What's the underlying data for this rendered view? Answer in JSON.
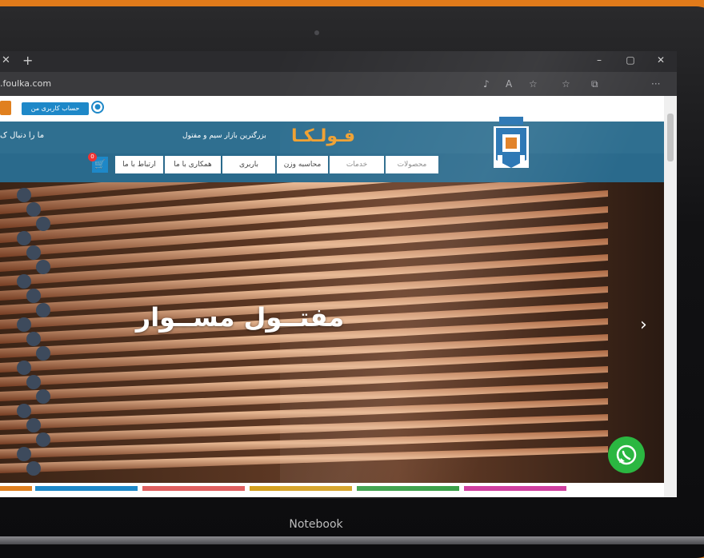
{
  "browser": {
    "tab_close": "✕",
    "tab_new": "+",
    "url": ".foulka.com",
    "controls": {
      "minimize": "–",
      "restore": "▢",
      "close": "✕"
    },
    "toolbar_icons": [
      "read-aloud-icon",
      "text-size-icon",
      "favorite-add-icon",
      "favorites-icon",
      "collections-icon",
      "more-icon"
    ],
    "more_label": "···"
  },
  "site": {
    "account_button": "حساب کاربری من",
    "follow_us": "ما را دنبال ک",
    "tagline": "بزرگترین بازار سیم و مفتول",
    "brand": "فـولـکـا",
    "nav": [
      "محصولات",
      "خدمات",
      "محاسبه وزن",
      "باربری",
      "همکاری با ما",
      "ارتباط با ما"
    ],
    "cart_count": "0",
    "hero_title": "مفتــول مســوار",
    "hero_next": "›"
  },
  "device": {
    "label": "Notebook"
  },
  "colors": {
    "accent": "#1e88c8",
    "header": "#2f6f90",
    "brand_orange": "#f0a030",
    "whatsapp": "#2bb741",
    "background": "#e07a1a"
  }
}
